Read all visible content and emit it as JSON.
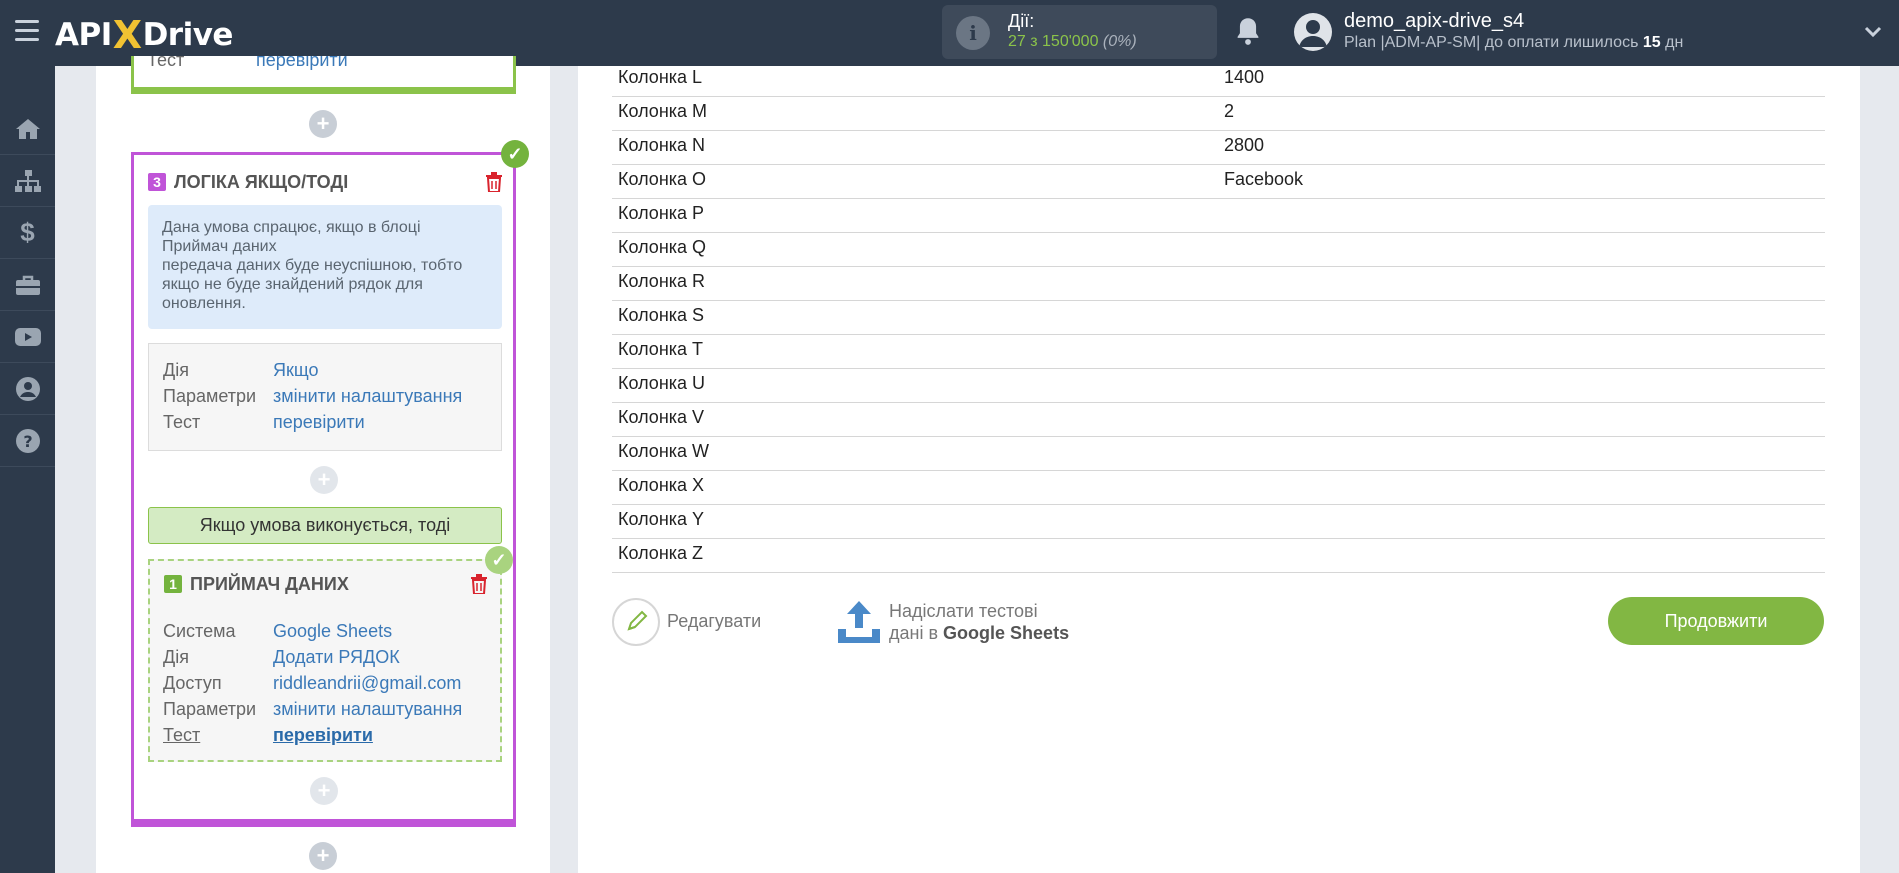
{
  "header": {
    "logo_a": "API",
    "logo_x": "X",
    "logo_b": "Drive",
    "actions_label": "Дії:",
    "actions_count": "27 з 150'000",
    "actions_pct": "(0%)",
    "user_name": "demo_apix-drive_s4",
    "plan_text": "Plan |ADM-AP-SM| до оплати лишилось",
    "plan_days": "15",
    "plan_unit": "дн"
  },
  "sidebar": {
    "items": [
      "home-icon",
      "sitemap-icon",
      "dollar-icon",
      "briefcase-icon",
      "youtube-icon",
      "user-icon",
      "help-icon"
    ]
  },
  "top_block": {
    "key": "Тест",
    "value": "перевірити"
  },
  "logic_block": {
    "number": "3",
    "title": "ЛОГІКА ЯКЩО/ТОДІ",
    "note_lines": [
      "Дана умова спрацює, якщо в блоці",
      "Приймач даних",
      "передача даних буде неуспішною, тобто",
      "якщо не буде знайдений рядок для",
      "оновлення."
    ],
    "rows": [
      {
        "key": "Дія",
        "value": "Якщо"
      },
      {
        "key": "Параметри",
        "value": "змінити налаштування"
      },
      {
        "key": "Тест",
        "value": "перевірити"
      }
    ],
    "condition_label": "Якщо умова виконується, тоді"
  },
  "receiver_block": {
    "number": "1",
    "title": "ПРИЙМАЧ ДАНИХ",
    "rows": [
      {
        "key": "Система",
        "value": "Google Sheets"
      },
      {
        "key": "Дія",
        "value": "Додати РЯДОК"
      },
      {
        "key": "Доступ",
        "value": "riddleandrii@gmail.com"
      },
      {
        "key": "Параметри",
        "value": "змінити налаштування"
      },
      {
        "key": "Тест",
        "value": "перевірити"
      }
    ]
  },
  "table": {
    "rows": [
      {
        "column": "Колонка L",
        "value": "1400"
      },
      {
        "column": "Колонка M",
        "value": "2"
      },
      {
        "column": "Колонка N",
        "value": "2800"
      },
      {
        "column": "Колонка O",
        "value": "Facebook"
      },
      {
        "column": "Колонка P",
        "value": ""
      },
      {
        "column": "Колонка Q",
        "value": ""
      },
      {
        "column": "Колонка R",
        "value": ""
      },
      {
        "column": "Колонка S",
        "value": ""
      },
      {
        "column": "Колонка T",
        "value": ""
      },
      {
        "column": "Колонка U",
        "value": ""
      },
      {
        "column": "Колонка V",
        "value": ""
      },
      {
        "column": "Колонка W",
        "value": ""
      },
      {
        "column": "Колонка X",
        "value": ""
      },
      {
        "column": "Колонка Y",
        "value": ""
      },
      {
        "column": "Колонка Z",
        "value": ""
      }
    ]
  },
  "footer": {
    "edit_label": "Редагувати",
    "send_line1": "Надіслати тестові",
    "send_line2_prefix": "дані в",
    "send_line2_target": "Google Sheets",
    "continue_label": "Продовжити"
  },
  "colors": {
    "accent_green": "#82b743",
    "logic_purple": "#c054d8",
    "link_blue": "#3b79b8",
    "topbar": "#2d3a4b"
  }
}
